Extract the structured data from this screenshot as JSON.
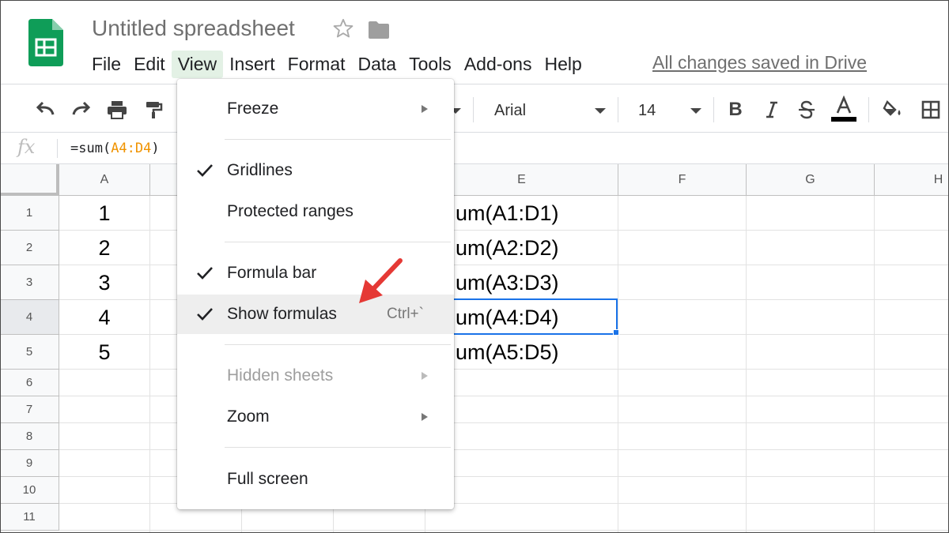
{
  "app": {
    "title": "Untitled spreadsheet",
    "save_status": "All changes saved in Drive"
  },
  "menubar": {
    "items": [
      "File",
      "Edit",
      "View",
      "Insert",
      "Format",
      "Data",
      "Tools",
      "Add-ons",
      "Help"
    ],
    "active": "View"
  },
  "toolbar": {
    "font": "Arial",
    "font_size": "14",
    "text_color": "#000000"
  },
  "formula_bar": {
    "fx": "fx",
    "prefix": "=sum(",
    "ref": "A4:D4",
    "suffix": ")"
  },
  "grid": {
    "columns": [
      "A",
      "",
      "",
      "",
      "E",
      "F",
      "G",
      "H"
    ],
    "rows": [
      "1",
      "2",
      "3",
      "4",
      "5",
      "6",
      "7",
      "8",
      "9",
      "10",
      "11"
    ],
    "selected_row": "4",
    "col_a_values": [
      "1",
      "2",
      "3",
      "4",
      "5"
    ],
    "col_e_values": [
      "um(A1:D1)",
      "um(A2:D2)",
      "um(A3:D3)",
      "um(A4:D4)",
      "um(A5:D5)"
    ]
  },
  "view_menu": {
    "freeze": "Freeze",
    "gridlines": "Gridlines",
    "protected_ranges": "Protected ranges",
    "formula_bar": "Formula bar",
    "show_formulas": "Show formulas",
    "show_formulas_shortcut": "Ctrl+`",
    "hidden_sheets": "Hidden sheets",
    "zoom": "Zoom",
    "full_screen": "Full screen"
  },
  "colors": {
    "brand_green": "#0f9d58",
    "selection_blue": "#1a73e8",
    "annotation_red": "#e53935",
    "menu_active_bg": "#e3f1e5"
  }
}
